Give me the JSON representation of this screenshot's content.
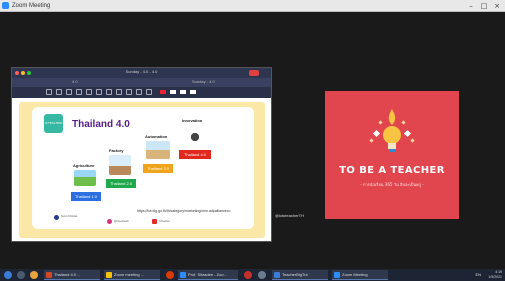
{
  "window": {
    "title": "Zoom Meeting"
  },
  "share": {
    "window_title": "Sunday - 4.0 - 4.0",
    "tab_left": "4.0",
    "tab_right": "Sunday - 4.0"
  },
  "slide": {
    "logo_text": "ICTEACHER",
    "title": "Thailand 4.0",
    "stages": [
      {
        "label": "Agriculture",
        "box": "Thailand 1.0",
        "color": "#2b6fe0"
      },
      {
        "label": "Factory",
        "box": "Thailand 2.0",
        "color": "#20a94b"
      },
      {
        "label": "Automation",
        "box": "Thailand 3.0",
        "color": "#f0a419"
      },
      {
        "label": "Innovation",
        "box": "Thailand 4.0",
        "color": "#e2271e"
      }
    ],
    "url": "https://ba.dig.go.th/th/category/marketing/chm.adpallianceco",
    "footer": [
      "Sumit Chimlao",
      "@icteacherth",
      "IcTeacher"
    ]
  },
  "participant": {
    "headline": "TO BE A TEACHER",
    "subline": "- การนักเรียน 365 วัน สิบละเป็นครู -",
    "name": "@ictoteacherTH",
    "bg_color": "#e1454e"
  },
  "taskbar": {
    "tasks": [
      "Thailand 4.0 ...",
      "Zoom meeting ...",
      "Prof. Sitasdee - Zoo...",
      "TeacherBigTut",
      "Zoom Meeting"
    ],
    "tray": "EN",
    "time": "4:19",
    "date": "1/3/2021"
  }
}
